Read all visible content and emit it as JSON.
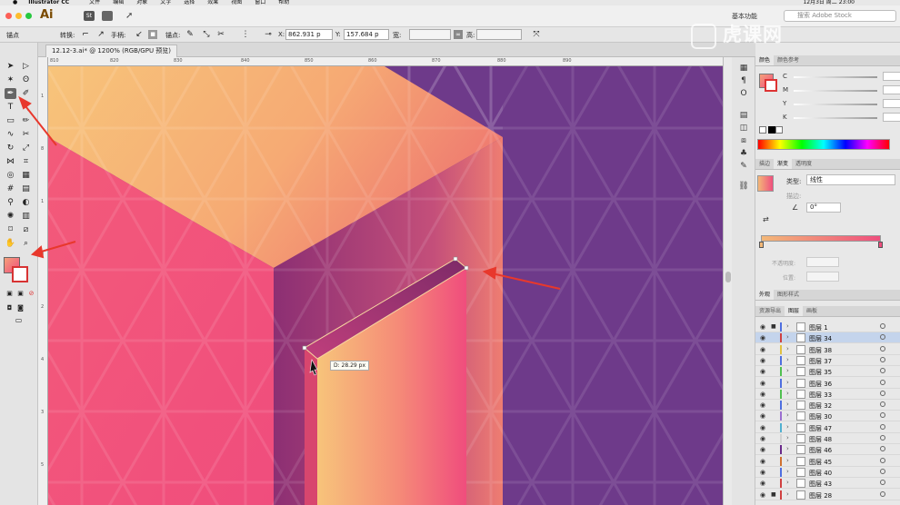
{
  "menubar": {
    "app_name": "Illustrator CC",
    "items": [
      "文件",
      "编辑",
      "对象",
      "文字",
      "选择",
      "效果",
      "视图",
      "窗口",
      "帮助"
    ],
    "clock": "12月3日 周二 23:00"
  },
  "appbar": {
    "logo": "Ai",
    "st": "St",
    "workspace": "基本功能",
    "stock_placeholder": "搜索 Adobe Stock"
  },
  "controlbar": {
    "mode_label": "锚点",
    "convert_label": "转换:",
    "handle_label": "手柄:",
    "anchor_label": "锚点:",
    "x_label": "X:",
    "x_value": "862.931 p",
    "y_label": "Y:",
    "y_value": "157.684 p",
    "w_label": "宽:",
    "h_label": "高:"
  },
  "document": {
    "tab_title": "12.12-3.ai* @ 1200% (RGB/GPU 预览)",
    "ruler_top": [
      "810",
      "820",
      "830",
      "840",
      "850",
      "860",
      "870",
      "880",
      "890"
    ],
    "ruler_left": [
      "1",
      "8",
      "1",
      "3",
      "2",
      "4",
      "3",
      "5"
    ],
    "distance_tooltip": "D: 28.29 px"
  },
  "panels": {
    "color_tabs": [
      "颜色",
      "颜色参考"
    ],
    "cmyk": [
      {
        "key": "C",
        "unit": "%"
      },
      {
        "key": "M",
        "unit": "%"
      },
      {
        "key": "Y",
        "unit": "%"
      },
      {
        "key": "K",
        "unit": "%"
      }
    ],
    "gradient_tabs": [
      "描边",
      "渐变",
      "透明度"
    ],
    "gradient_type_label": "类型:",
    "gradient_type_value": "线性",
    "stroke_label": "描边:",
    "angle_value": "0°",
    "opacity_label": "不透明度:",
    "position_label": "位置:",
    "appearance_tabs": [
      "外观",
      "图形样式"
    ],
    "layers_tabs": [
      "资源导出",
      "图层",
      "画板"
    ],
    "layers": [
      {
        "name": "图层 1",
        "color": "#4f6fe0",
        "locked": true,
        "selected": false
      },
      {
        "name": "图层 34",
        "color": "#d04040",
        "locked": false,
        "selected": true
      },
      {
        "name": "图层 38",
        "color": "#e0c040",
        "locked": false,
        "selected": false
      },
      {
        "name": "图层 37",
        "color": "#4f6fe0",
        "locked": false,
        "selected": false
      },
      {
        "name": "图层 35",
        "color": "#50c050",
        "locked": false,
        "selected": false
      },
      {
        "name": "图层 36",
        "color": "#4f6fe0",
        "locked": false,
        "selected": false
      },
      {
        "name": "图层 33",
        "color": "#50c050",
        "locked": false,
        "selected": false
      },
      {
        "name": "图层 32",
        "color": "#4f6fe0",
        "locked": false,
        "selected": false
      },
      {
        "name": "图层 30",
        "color": "#9b6fd0",
        "locked": false,
        "selected": false
      },
      {
        "name": "图层 47",
        "color": "#50b0d0",
        "locked": false,
        "selected": false
      },
      {
        "name": "图层 48",
        "color": "#d0d0d0",
        "locked": false,
        "selected": false
      },
      {
        "name": "图层 46",
        "color": "#6a2a8a",
        "locked": false,
        "selected": false
      },
      {
        "name": "图层 45",
        "color": "#d07030",
        "locked": false,
        "selected": false
      },
      {
        "name": "图层 40",
        "color": "#4f6fe0",
        "locked": false,
        "selected": false
      },
      {
        "name": "图层 43",
        "color": "#d04040",
        "locked": false,
        "selected": false
      },
      {
        "name": "图层 28",
        "color": "#d04040",
        "locked": true,
        "selected": false
      }
    ]
  },
  "watermark": "虎课网",
  "colors": {
    "purple_bg": "#6e3a8a",
    "pink": "#ef4f7e",
    "orange": "#f5b878",
    "arrow_red": "#e8382c"
  }
}
